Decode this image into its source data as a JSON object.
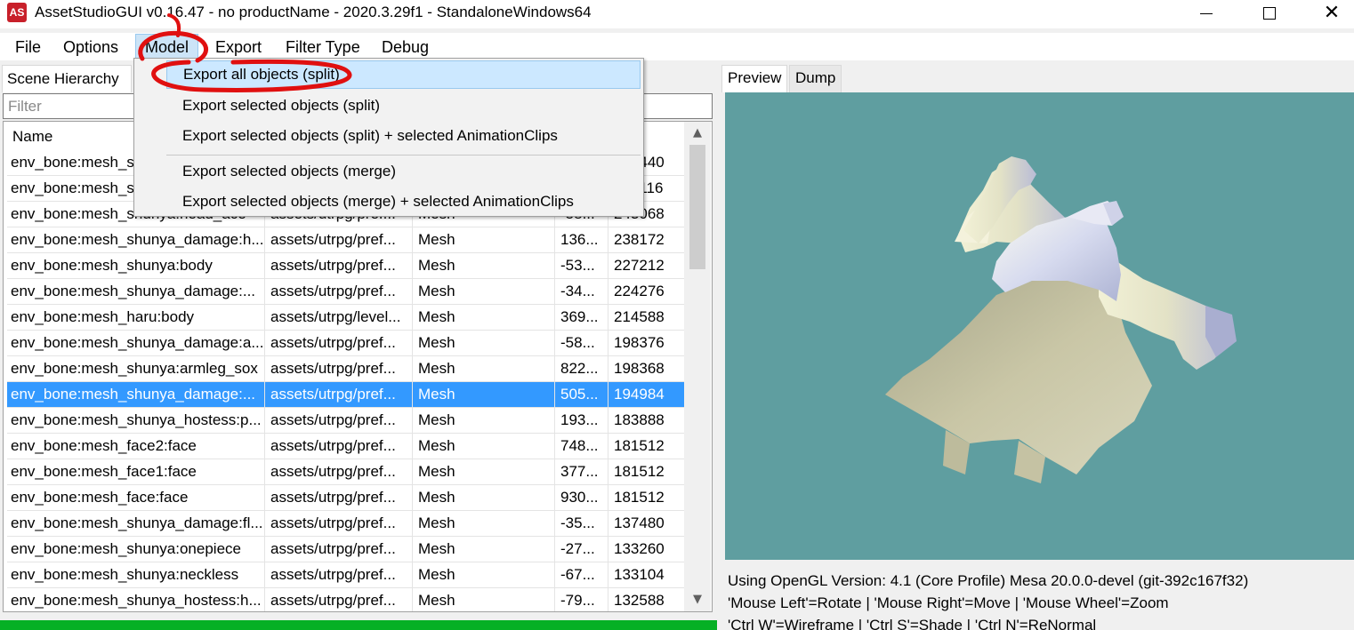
{
  "window": {
    "app_icon_text": "AS",
    "title": "AssetStudioGUI v0.16.47 - no productName - 2020.3.29f1 - StandaloneWindows64",
    "minimize": "minimize",
    "maximize": "maximize",
    "close": "✕"
  },
  "menubar": {
    "items": [
      "File",
      "Options",
      "Model",
      "Export",
      "Filter Type",
      "Debug"
    ],
    "active": "Model"
  },
  "left_panel": {
    "tabs": [
      "Scene Hierarchy"
    ],
    "filter_placeholder": "Filter",
    "columns": [
      "Name",
      "Container",
      "Type",
      "PathID",
      "Size"
    ],
    "rows": [
      {
        "name": "env_bone:mesh_s",
        "container": "",
        "type": "",
        "pathid": "",
        "size": "245440"
      },
      {
        "name": "env_bone:mesh_s",
        "container": "",
        "type": "",
        "pathid": "",
        "size": "245116"
      },
      {
        "name": "env_bone:mesh_shunya:head_ace",
        "container": "assets/utrpg/pref...",
        "type": "Mesh",
        "pathid": "-58...",
        "size": "243068"
      },
      {
        "name": "env_bone:mesh_shunya_damage:h...",
        "container": "assets/utrpg/pref...",
        "type": "Mesh",
        "pathid": "136...",
        "size": "238172"
      },
      {
        "name": "env_bone:mesh_shunya:body",
        "container": "assets/utrpg/pref...",
        "type": "Mesh",
        "pathid": "-53...",
        "size": "227212"
      },
      {
        "name": "env_bone:mesh_shunya_damage:...",
        "container": "assets/utrpg/pref...",
        "type": "Mesh",
        "pathid": "-34...",
        "size": "224276"
      },
      {
        "name": "env_bone:mesh_haru:body",
        "container": "assets/utrpg/level...",
        "type": "Mesh",
        "pathid": "369...",
        "size": "214588"
      },
      {
        "name": "env_bone:mesh_shunya_damage:a...",
        "container": "assets/utrpg/pref...",
        "type": "Mesh",
        "pathid": "-58...",
        "size": "198376"
      },
      {
        "name": "env_bone:mesh_shunya:armleg_sox",
        "container": "assets/utrpg/pref...",
        "type": "Mesh",
        "pathid": "822...",
        "size": "198368"
      },
      {
        "name": "env_bone:mesh_shunya_damage:...",
        "container": "assets/utrpg/pref...",
        "type": "Mesh",
        "pathid": "505...",
        "size": "194984",
        "selected": true
      },
      {
        "name": "env_bone:mesh_shunya_hostess:p...",
        "container": "assets/utrpg/pref...",
        "type": "Mesh",
        "pathid": "193...",
        "size": "183888"
      },
      {
        "name": "env_bone:mesh_face2:face",
        "container": "assets/utrpg/pref...",
        "type": "Mesh",
        "pathid": "748...",
        "size": "181512"
      },
      {
        "name": "env_bone:mesh_face1:face",
        "container": "assets/utrpg/pref...",
        "type": "Mesh",
        "pathid": "377...",
        "size": "181512"
      },
      {
        "name": "env_bone:mesh_face:face",
        "container": "assets/utrpg/pref...",
        "type": "Mesh",
        "pathid": "930...",
        "size": "181512"
      },
      {
        "name": "env_bone:mesh_shunya_damage:fl...",
        "container": "assets/utrpg/pref...",
        "type": "Mesh",
        "pathid": "-35...",
        "size": "137480"
      },
      {
        "name": "env_bone:mesh_shunya:onepiece",
        "container": "assets/utrpg/pref...",
        "type": "Mesh",
        "pathid": "-27...",
        "size": "133260"
      },
      {
        "name": "env_bone:mesh_shunya:neckless",
        "container": "assets/utrpg/pref...",
        "type": "Mesh",
        "pathid": "-67...",
        "size": "133104"
      },
      {
        "name": "env_bone:mesh_shunya_hostess:h...",
        "container": "assets/utrpg/pref...",
        "type": "Mesh",
        "pathid": "-79...",
        "size": "132588"
      }
    ],
    "scroll_up": "▲",
    "scroll_down": "▼",
    "progress_fraction": 1.0,
    "progress_color": "#06b025"
  },
  "right_panel": {
    "tabs": [
      "Preview",
      "Dump"
    ],
    "preview_bg": "#5f9ea0",
    "gl_info": [
      "Using OpenGL Version: 4.1 (Core Profile) Mesa 20.0.0-devel (git-392c167f32)",
      "'Mouse Left'=Rotate | 'Mouse Right'=Move | 'Mouse Wheel'=Zoom",
      "'Ctrl W'=Wireframe | 'Ctrl S'=Shade | 'Ctrl N'=ReNormal"
    ]
  },
  "model_menu": {
    "items": [
      "Export all objects (split)",
      "Export selected objects (split)",
      "Export selected objects (split) + selected AnimationClips",
      "Export selected objects (merge)",
      "Export selected objects (merge) + selected AnimationClips"
    ],
    "highlighted": "Export all objects (split)"
  },
  "colors": {
    "selection": "#3399ff",
    "menu_highlight": "#cce8ff",
    "annotation": "#e01010"
  }
}
